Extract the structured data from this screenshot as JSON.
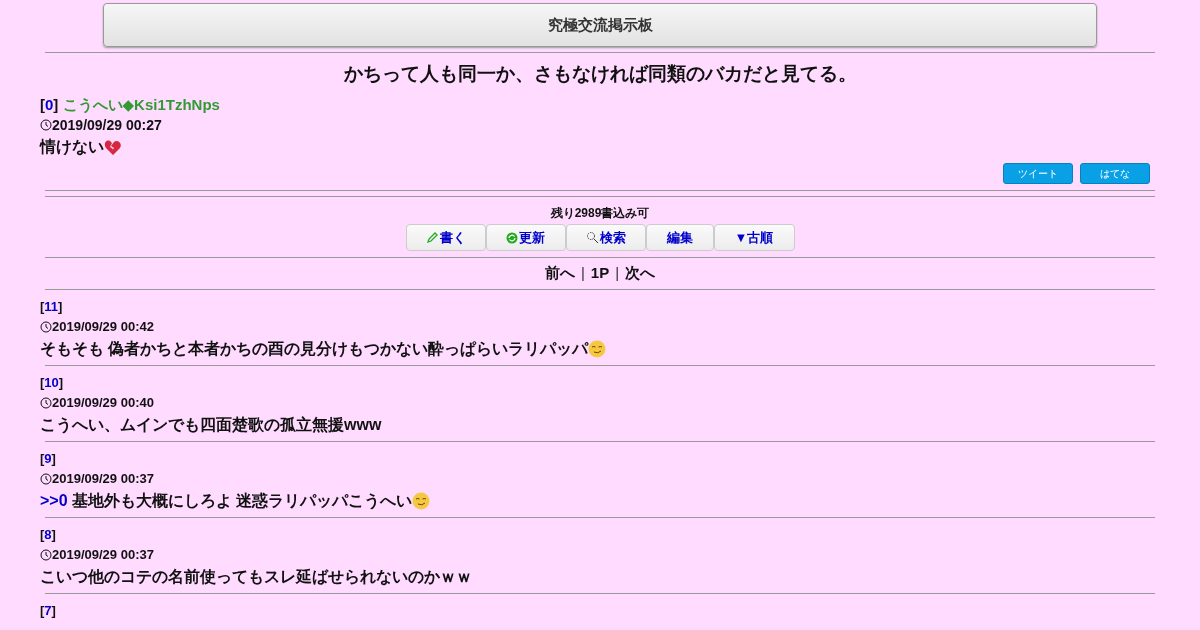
{
  "header": {
    "title": "究極交流掲示板"
  },
  "thread": {
    "title": "かちって人も同一か、さもなければ同類のバカだと見てる。",
    "number": "[0]",
    "author": "こうへい◆Ksi1TzhNps",
    "date": "2019/09/29 00:27",
    "body": "情けない",
    "kind": "broken_heart"
  },
  "share_buttons": [
    "ツイート",
    "はてな"
  ],
  "remaining": "残り2989書込み可",
  "toolbar": [
    {
      "label": "書く",
      "kind": "pencil"
    },
    {
      "label": "更新",
      "kind": "refresh"
    },
    {
      "label": "検索",
      "kind": "search"
    },
    {
      "label": "編集",
      "kind": "plain"
    },
    {
      "label": "▼古順",
      "kind": "plain"
    }
  ],
  "pager": [
    {
      "text": "前へ",
      "kind": "link"
    },
    {
      "text": "|",
      "kind": "separator"
    },
    {
      "text": "1P",
      "kind": "link"
    },
    {
      "text": "|",
      "kind": "separator"
    },
    {
      "text": "次へ",
      "kind": "link"
    }
  ],
  "posts": [
    {
      "number": "[11]",
      "date": "2019/09/29 00:42",
      "body": "そもそも 偽者かちと本者かちの酉の見分けもつかない酔っぱらいラリパッパ",
      "kind": "smirk"
    },
    {
      "number": "[10]",
      "date": "2019/09/29 00:40",
      "body": "こうへい、ムインでも四面楚歌の孤立無援www",
      "kind": "plain"
    },
    {
      "number": "[9]",
      "date": "2019/09/29 00:37",
      "reply_to": ">>0",
      "body": "基地外も大概にしろよ 迷惑ラリパッパこうへい",
      "kind": "smirk"
    },
    {
      "number": "[8]",
      "date": "2019/09/29 00:37",
      "body": "こいつ他のコテの名前使ってもスレ延ばせられないのかｗｗ",
      "kind": "plain"
    },
    {
      "number": "[7]"
    }
  ]
}
